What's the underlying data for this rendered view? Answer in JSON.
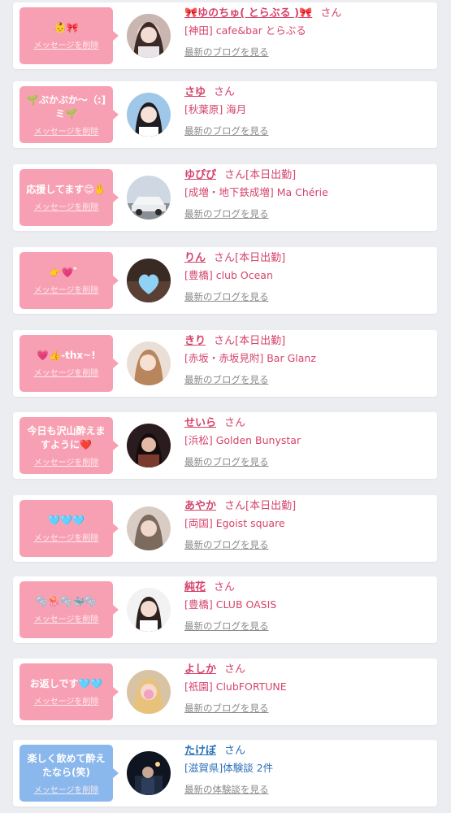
{
  "colors": {
    "pink_bubble": "#f8a0b3",
    "blue_bubble": "#8ab7ec",
    "pink_text": "#d6446c",
    "blue_text": "#2a6fb8",
    "background": "#ecedf1"
  },
  "cards": [
    {
      "message": "👶🎀",
      "delete_label": "メッセージを削除",
      "avatar_icon": "girl-photo-avatar",
      "name": "🎀ゆのちゅ( とらぶる )🎀",
      "san": "さん",
      "status": "",
      "shop": "[神田] cafe&bar とらぶる",
      "blog_link": "最新のブログを見る",
      "theme": "pink"
    },
    {
      "message": "🌱ぷかぷか〜（:]ミ🌱",
      "delete_label": "メッセージを削除",
      "avatar_icon": "girl-photo-avatar",
      "name": "さゆ",
      "san": "さん",
      "status": "",
      "shop": "[秋葉原] 海月",
      "blog_link": "最新のブログを見る",
      "theme": "pink"
    },
    {
      "message": "応援してます😊✋",
      "delete_label": "メッセージを削除",
      "avatar_icon": "car-photo-avatar",
      "name": "ゆぴぴ",
      "san": "さん",
      "status": "[本日出勤]",
      "shop": "[成増・地下鉄成増] Ma Chérie",
      "blog_link": "最新のブログを見る",
      "theme": "pink"
    },
    {
      "message": "👉💗゛",
      "delete_label": "メッセージを削除",
      "avatar_icon": "heart-avatar",
      "name": "りん",
      "san": "さん",
      "status": "[本日出勤]",
      "shop": "[豊橋] club Ocean",
      "blog_link": "最新のブログを見る",
      "theme": "pink"
    },
    {
      "message": "💗👍-thx~!",
      "delete_label": "メッセージを削除",
      "avatar_icon": "girl-photo-avatar",
      "name": "きり",
      "san": "さん",
      "status": "[本日出勤]",
      "shop": "[赤坂・赤坂見附] Bar Glanz",
      "blog_link": "最新のブログを見る",
      "theme": "pink"
    },
    {
      "message": "今日も沢山酔えますように❤️",
      "delete_label": "メッセージを削除",
      "avatar_icon": "girl-photo-avatar",
      "name": "せいら",
      "san": "さん",
      "status": "",
      "shop": "[浜松] Golden Bunystar",
      "blog_link": "最新のブログを見る",
      "theme": "pink"
    },
    {
      "message": "🩵🩵🩵",
      "delete_label": "メッセージを削除",
      "avatar_icon": "girl-photo-avatar",
      "name": "あやか",
      "san": "さん",
      "status": "[本日出勤]",
      "shop": "[両国] Egoist square",
      "blog_link": "最新のブログを見る",
      "theme": "pink"
    },
    {
      "message": "🫧🪼🫧🐳🫧",
      "delete_label": "メッセージを削除",
      "avatar_icon": "girl-photo-avatar",
      "name": "純花",
      "san": "さん",
      "status": "",
      "shop": "[豊橋] CLUB OASIS",
      "blog_link": "最新のブログを見る",
      "theme": "pink"
    },
    {
      "message": "お返しです🩵🩵",
      "delete_label": "メッセージを削除",
      "avatar_icon": "girl-photo-avatar",
      "name": "よしか",
      "san": "さん",
      "status": "",
      "shop": "[祇園] ClubFORTUNE",
      "blog_link": "最新のブログを見る",
      "theme": "pink"
    },
    {
      "message": "楽しく飲めて酔えたなら(笑)",
      "delete_label": "メッセージを削除",
      "avatar_icon": "night-photo-avatar",
      "name": "たけぼ",
      "san": "さん",
      "status": "",
      "shop": "[滋賀県]体験談 2件",
      "blog_link": "最新の体験談を見る",
      "theme": "blue"
    }
  ]
}
